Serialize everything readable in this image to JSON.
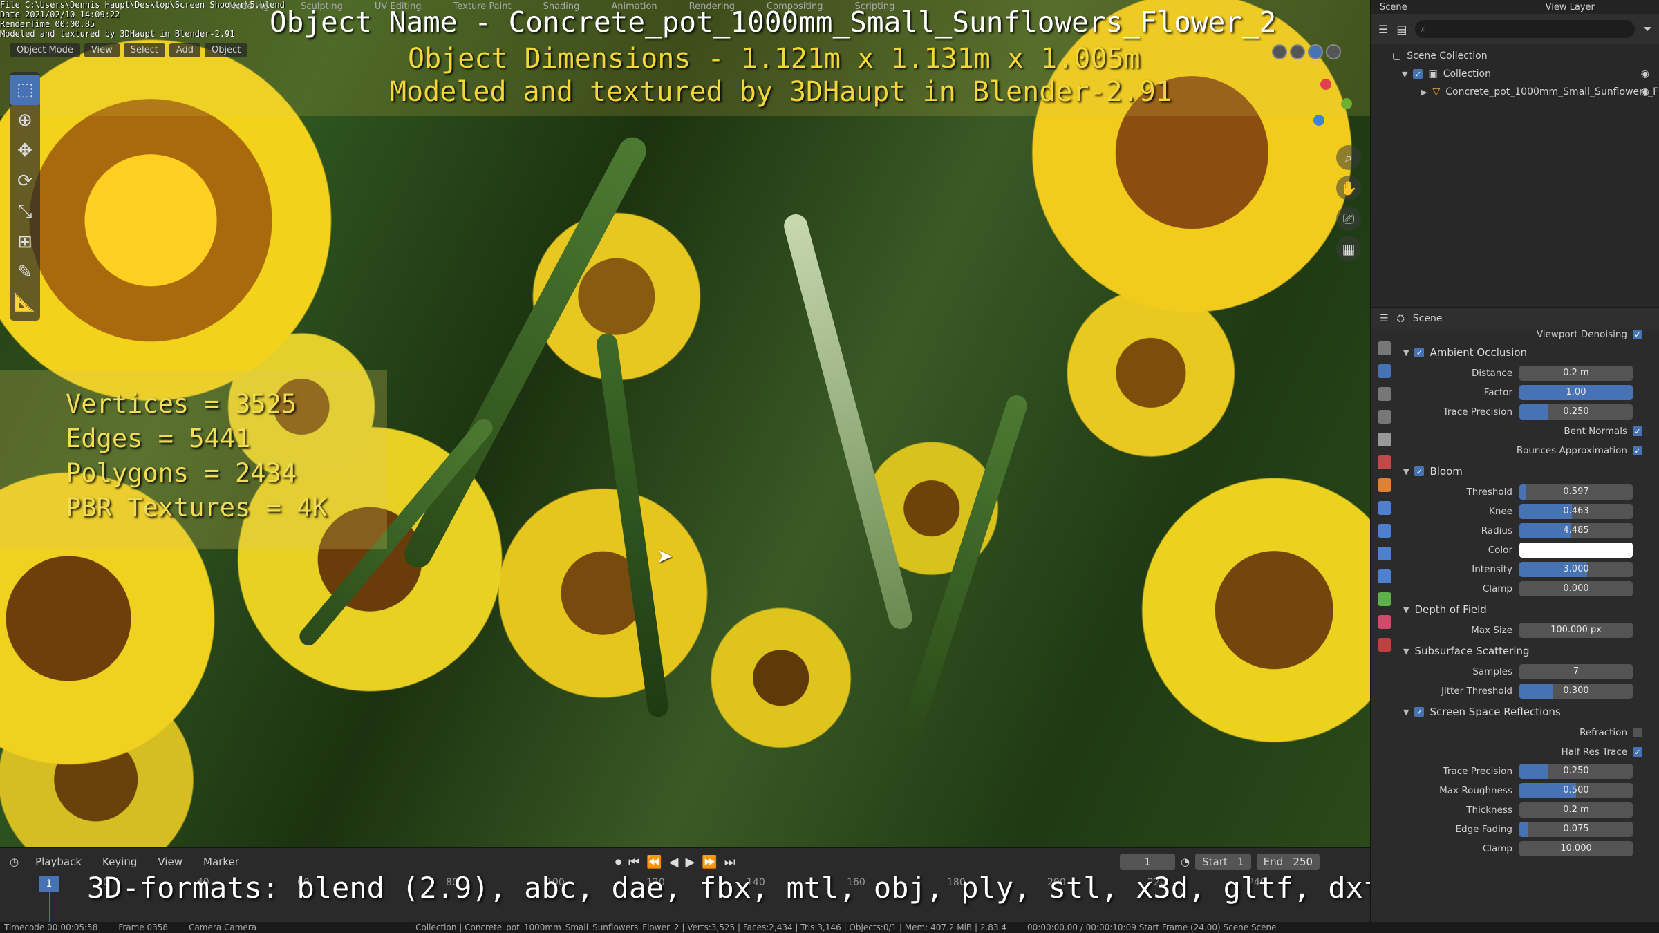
{
  "viewport": {
    "info_lines": [
      "File C:\\Users\\Dennis Haupt\\Desktop\\Screen Shooter\\5.blend",
      "Date 2021/02/10 14:09:22",
      "RenderTime 00:00.85",
      "Modeled and textured by 3DHaupt in Blender-2.91"
    ],
    "top_menus": [
      "Modeling",
      "Sculpting",
      "UV Editing",
      "Texture Paint",
      "Shading",
      "Animation",
      "Rendering",
      "Compositing",
      "Scripting"
    ],
    "mode_bar": [
      "Object Mode",
      "View",
      "Select",
      "Add",
      "Object"
    ],
    "object_name": "Object Name - Concrete_pot_1000mm_Small_Sunflowers_Flower_2",
    "object_dims": "Object Dimensions -  1.121m x 1.131m x 1.005m",
    "modeled_by": "Modeled and textured by 3DHaupt in Blender-2.91",
    "stats": [
      "Vertices = 3525",
      "Edges = 5441",
      "Polygons = 2434",
      "PBR Textures = 4K"
    ],
    "tools": [
      "select-icon",
      "cursor-icon",
      "move-icon",
      "rotate-icon",
      "scale-icon",
      "transform-icon",
      "annotate-icon",
      "measure-icon"
    ],
    "tool_glyphs": [
      "⬚",
      "⊕",
      "✥",
      "⟳",
      "⤡",
      "⊞",
      "✎",
      "📐"
    ]
  },
  "timeline": {
    "menus": [
      "Playback",
      "Keying",
      "View",
      "Marker"
    ],
    "current_frame": "1",
    "frame_field": "1",
    "start_label": "Start",
    "start_value": "1",
    "end_label": "End",
    "end_value": "250",
    "ticks": [
      "20",
      "40",
      "60",
      "80",
      "100",
      "120",
      "140",
      "160",
      "180",
      "200",
      "220",
      "240"
    ],
    "formats": "3D-formats: blend (2.9), abc, dae, fbx, mtl, obj, ply, stl, x3d, gltf, dxf"
  },
  "statusbar": {
    "left": [
      "Timecode 00:00:05:58",
      "Frame 0358",
      "Camera Camera"
    ],
    "right": "Collection | Concrete_pot_1000mm_Small_Sunflowers_Flower_2 | Verts:3,525 | Faces:2,434 | Tris:3,146 | Objects:0/1 | Mem: 407.2 MiB | 2.83.4",
    "time": "00:00:00.00 / 00:00:10:09   Start Frame (24.00)   Scene   Scene"
  },
  "top_header": {
    "scene": "Scene",
    "view_layer": "View Layer"
  },
  "outliner": {
    "scene_collection": "Scene Collection",
    "collection": "Collection",
    "object": "Concrete_pot_1000mm_Small_Sunflowers_F"
  },
  "properties": {
    "context": "Scene",
    "viewport_denoising": "Viewport Denoising",
    "ao": {
      "title": "Ambient Occlusion",
      "distance_label": "Distance",
      "distance": "0.2 m",
      "factor_label": "Factor",
      "factor": "1.00",
      "factor_fill": 1.0,
      "trace_label": "Trace Precision",
      "trace": "0.250",
      "trace_fill": 0.25,
      "bent_normals": "Bent Normals",
      "bounces": "Bounces Approximation"
    },
    "bloom": {
      "title": "Bloom",
      "threshold_label": "Threshold",
      "threshold": "0.597",
      "threshold_fill": 0.06,
      "knee_label": "Knee",
      "knee": "0.463",
      "knee_fill": 0.463,
      "radius_label": "Radius",
      "radius": "4.485",
      "radius_fill": 0.45,
      "color_label": "Color",
      "intensity_label": "Intensity",
      "intensity": "3.000",
      "intensity_fill": 0.6,
      "clamp_label": "Clamp",
      "clamp": "0.000"
    },
    "dof": {
      "title": "Depth of Field",
      "maxsize_label": "Max Size",
      "maxsize": "100.000 px"
    },
    "sss": {
      "title": "Subsurface Scattering",
      "samples_label": "Samples",
      "samples": "7",
      "jitter_label": "Jitter Threshold",
      "jitter": "0.300",
      "jitter_fill": 0.3
    },
    "ssr": {
      "title": "Screen Space Reflections",
      "refraction": "Refraction",
      "half_res": "Half Res Trace",
      "trace_label": "Trace Precision",
      "trace": "0.250",
      "trace_fill": 0.25,
      "rough_label": "Max Roughness",
      "rough": "0.500",
      "rough_fill": 0.5,
      "thick_label": "Thickness",
      "thick": "0.2 m",
      "edge_label": "Edge Fading",
      "edge": "0.075",
      "edge_fill": 0.075,
      "clamp_label": "Clamp",
      "clamp": "10.000"
    }
  },
  "colors": {
    "accent": "#4772b3",
    "panel": "#2b2b2b",
    "overlay_yellow": "#f2d63a"
  }
}
